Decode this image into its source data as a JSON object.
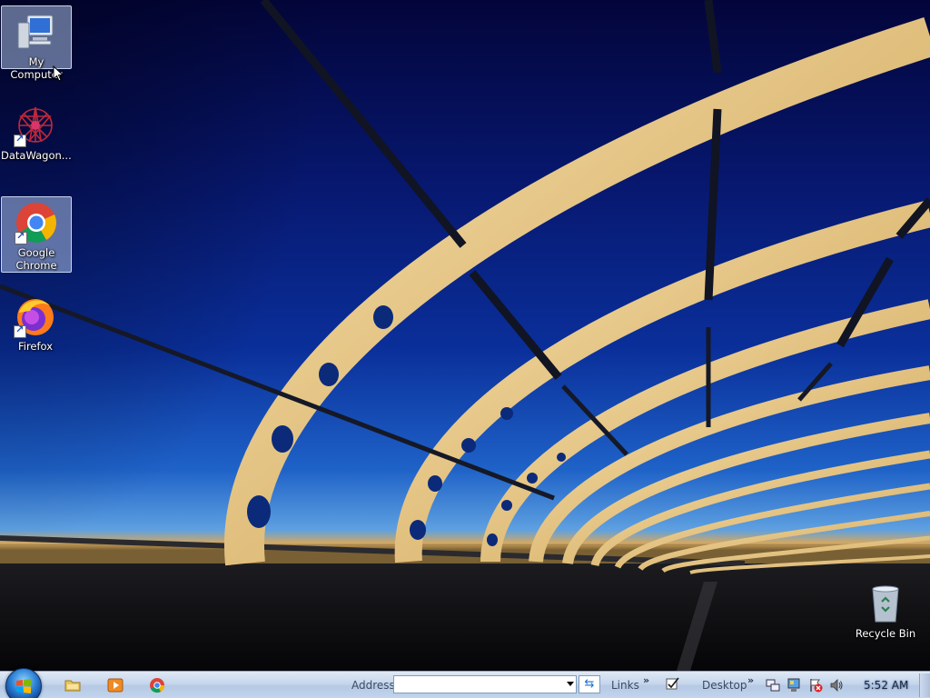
{
  "desktop": {
    "icons": [
      {
        "label": "My Computer",
        "icon": "computer-icon",
        "selected": true
      },
      {
        "label": "DataWagon...",
        "icon": "datawagon-icon",
        "selected": false
      },
      {
        "label": "Google Chrome",
        "icon": "chrome-icon",
        "selected": true
      },
      {
        "label": "Firefox",
        "icon": "firefox-icon",
        "selected": false
      }
    ],
    "recycle_bin": {
      "label": "Recycle Bin",
      "icon": "recycle-bin-icon"
    }
  },
  "taskbar": {
    "quick_launch": [
      "explorer-folder-icon",
      "media-player-icon",
      "chrome-icon"
    ],
    "address_label": "Address",
    "address_value": "",
    "links_label": "Links",
    "desktop_label": "Desktop",
    "clock": "5:52 AM",
    "chevron": "»"
  },
  "colors": {
    "sky_top": "#03053a",
    "sky_mid": "#0a2f9a",
    "bridge_gold": "#e8c27a",
    "taskbar": "#c6d6ec"
  }
}
